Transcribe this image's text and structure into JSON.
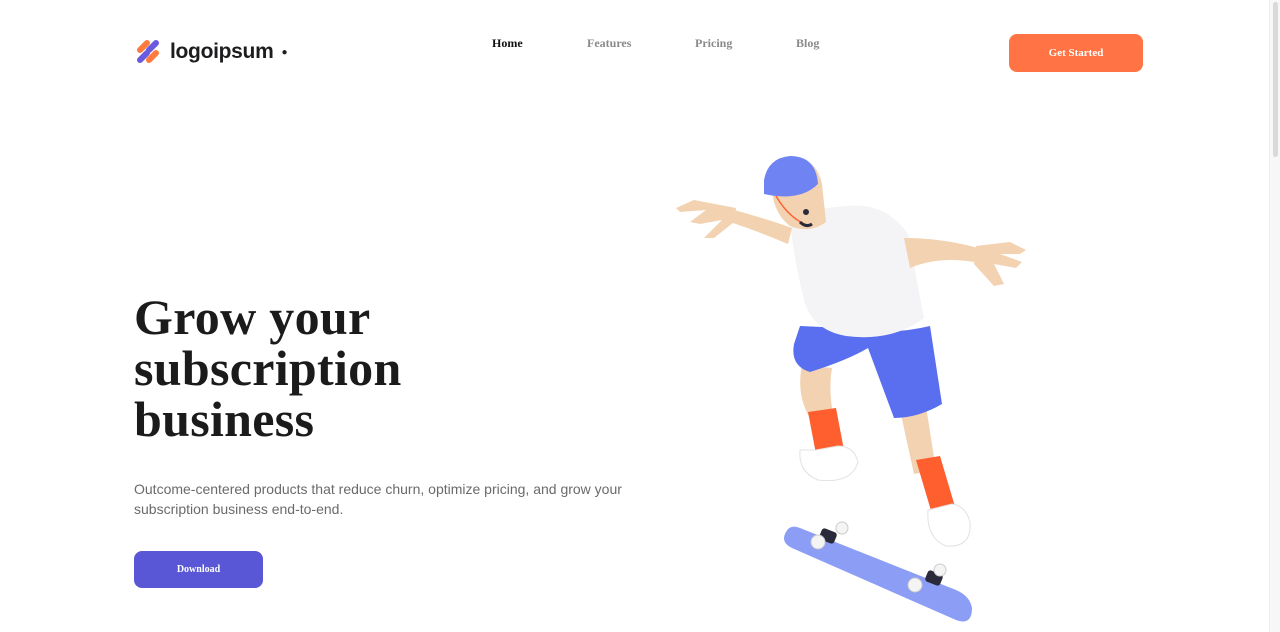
{
  "brand": {
    "name": "logoipsum"
  },
  "nav": {
    "items": [
      {
        "label": "Home",
        "active": true
      },
      {
        "label": "Features",
        "active": false
      },
      {
        "label": "Pricing",
        "active": false
      },
      {
        "label": "Blog",
        "active": false
      }
    ]
  },
  "header": {
    "cta_label": "Get Started"
  },
  "hero": {
    "title_lines": [
      "Grow your",
      "subscription",
      "business"
    ],
    "subtitle": "Outcome-centered products that reduce churn, optimize pricing, and grow your subscription business end-to-end.",
    "download_label": "Download"
  },
  "colors": {
    "accent_orange": "#ff7344",
    "primary_purple": "#5a57d6",
    "illustration_blue": "#6f84f2"
  },
  "icons": {
    "logo": "logoipsum-mark-icon",
    "illustration": "skateboarder-illustration"
  }
}
